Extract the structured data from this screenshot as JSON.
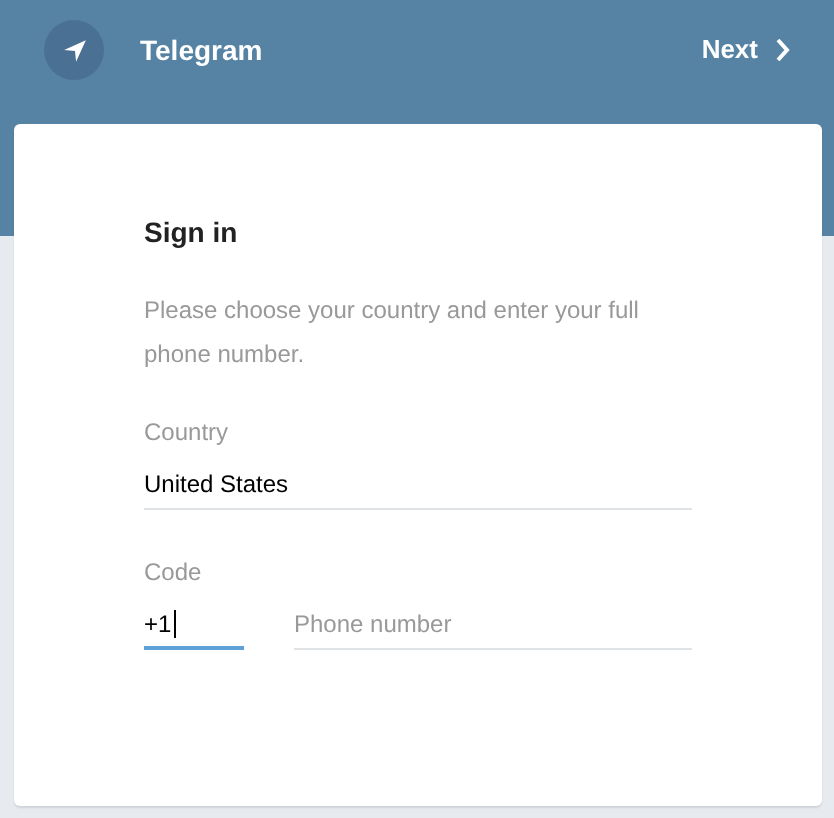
{
  "header": {
    "title": "Telegram",
    "next_button": "Next"
  },
  "card": {
    "title": "Sign in",
    "description": "Please choose your country and enter your full phone number.",
    "country": {
      "label": "Country",
      "value": "United States",
      "focused": false
    },
    "code": {
      "label": "Code",
      "value": "+1",
      "focused": true
    },
    "phone": {
      "placeholder": "Phone number",
      "focused": false
    }
  }
}
